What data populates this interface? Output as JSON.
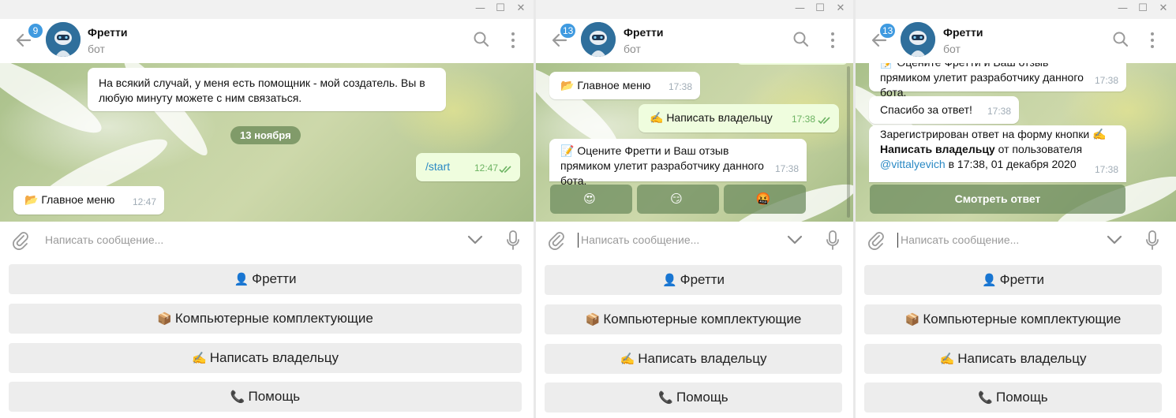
{
  "window_controls": {
    "minimize": "—",
    "maximize": "☐",
    "close": "✕"
  },
  "header": {
    "name": "Фретти",
    "subtitle": "бот",
    "badges": [
      "9",
      "13",
      "13"
    ],
    "search_icon": "search-icon",
    "more_icon": "more-vertical-icon"
  },
  "colors": {
    "accent": "#3f9ae0",
    "outgoing_bubble": "#effdde",
    "time_out": "#6cb362"
  },
  "panel1": {
    "msg1": "На всякий случай, у меня есть помощник - мой создатель. Вы в любую минуту можете с ним связаться.",
    "date": "13 ноября",
    "out_text": "/start",
    "out_time": "12:47",
    "menu_text": "📂 Главное меню",
    "menu_time": "12:47"
  },
  "panel2": {
    "menu_text": "📂 Главное меню",
    "menu_time": "17:38",
    "out_text": "✍️ Написать владельцу",
    "out_time": "17:38",
    "survey_text": "📝 Оцените Фретти и Ваш отзыв прямиком улетит разработчику данного бота.",
    "survey_time": "17:38",
    "reactions": [
      "😍",
      "😏",
      "🤬"
    ]
  },
  "panel3": {
    "survey_text": "📝 Оцените Фретти и Ваш отзыв прямиком улетит разработчику данного бота.",
    "survey_time": "17:38",
    "thanks_text": "Спасибо за ответ!",
    "thanks_time": "17:38",
    "reg_line1": "Зарегистрирован ответ на форму кнопки ✍️",
    "reg_bold": "Написать владельцу",
    "reg_after": " от пользователя",
    "reg_user": "@vittalyevich",
    "reg_date": " в 17:38, 01 декабря 2020",
    "reg_time": "17:38",
    "view_button": "Смотреть ответ"
  },
  "input": {
    "placeholder": "Написать сообщение..."
  },
  "keyboard": [
    {
      "emoji": "👤",
      "label": "Фретти"
    },
    {
      "emoji": "📦",
      "label": "Компьютерные комплектующие"
    },
    {
      "emoji": "✍️",
      "label": "Написать владельцу"
    },
    {
      "emoji": "📞",
      "label": "Помощь"
    }
  ]
}
